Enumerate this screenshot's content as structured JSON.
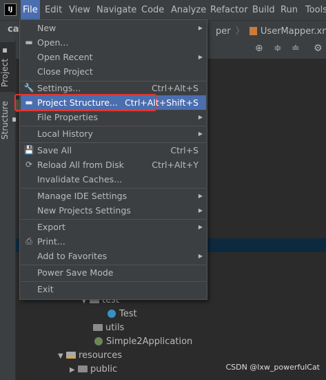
{
  "menubar": {
    "app_icon": "IJ",
    "items": [
      "File",
      "Edit",
      "View",
      "Navigate",
      "Code",
      "Analyze",
      "Refactor",
      "Build",
      "Run",
      "Tools"
    ]
  },
  "breadcrumb": {
    "project_fragment": "cat",
    "path_fragment": "per",
    "file": "UserMapper.xml"
  },
  "sidebar": {
    "project_tab": "Project",
    "structure_tab": "Structure"
  },
  "file_menu": {
    "items": [
      {
        "label": "New",
        "mnemonic": "N",
        "submenu": true
      },
      {
        "label": "Open...",
        "mnemonic": "O",
        "icon": "folder-open-icon"
      },
      {
        "label": "Open Recent",
        "mnemonic": "R",
        "submenu": true
      },
      {
        "label": "Close Project"
      },
      {
        "label": "Settings...",
        "mnemonic": "t",
        "icon": "wrench-icon",
        "shortcut": "Ctrl+Alt+S"
      },
      {
        "label": "Project Structure...",
        "icon": "project-structure-icon",
        "shortcut": "Ctrl+Alt+Shift+S",
        "selected": true
      },
      {
        "label": "File Properties",
        "submenu": true
      },
      {
        "label": "Local History",
        "mnemonic": "H",
        "submenu": true
      },
      {
        "label": "Save All",
        "mnemonic": "S",
        "icon": "save-icon",
        "shortcut": "Ctrl+S"
      },
      {
        "label": "Reload All from Disk",
        "icon": "reload-icon",
        "shortcut": "Ctrl+Alt+Y"
      },
      {
        "label": "Invalidate Caches..."
      },
      {
        "label": "Manage IDE Settings",
        "submenu": true
      },
      {
        "label": "New Projects Settings",
        "submenu": true
      },
      {
        "label": "Export",
        "submenu": true
      },
      {
        "label": "Print...",
        "mnemonic": "P",
        "icon": "print-icon"
      },
      {
        "label": "Add to Favorites",
        "mnemonic": "F",
        "submenu": true
      },
      {
        "label": "Power Save Mode"
      },
      {
        "label": "Exit",
        "mnemonic": "x"
      }
    ]
  },
  "project_tree": {
    "nodes": [
      {
        "label": "test",
        "kind": "folder",
        "expanded": true
      },
      {
        "label": "Test",
        "kind": "class"
      },
      {
        "label": "utils",
        "kind": "folder"
      },
      {
        "label": "Simple2Application",
        "kind": "spring-class"
      },
      {
        "label": "resources",
        "kind": "resources-folder",
        "expanded": true
      },
      {
        "label": "public",
        "kind": "folder",
        "expanded": false
      }
    ]
  },
  "watermark": "CSDN @lxw_powerfulCat",
  "colors": {
    "menu_bg": "#3c3f41",
    "selection": "#4b6eaf",
    "highlight_box": "#e3352f",
    "editor_bg": "#2b2b2b"
  }
}
